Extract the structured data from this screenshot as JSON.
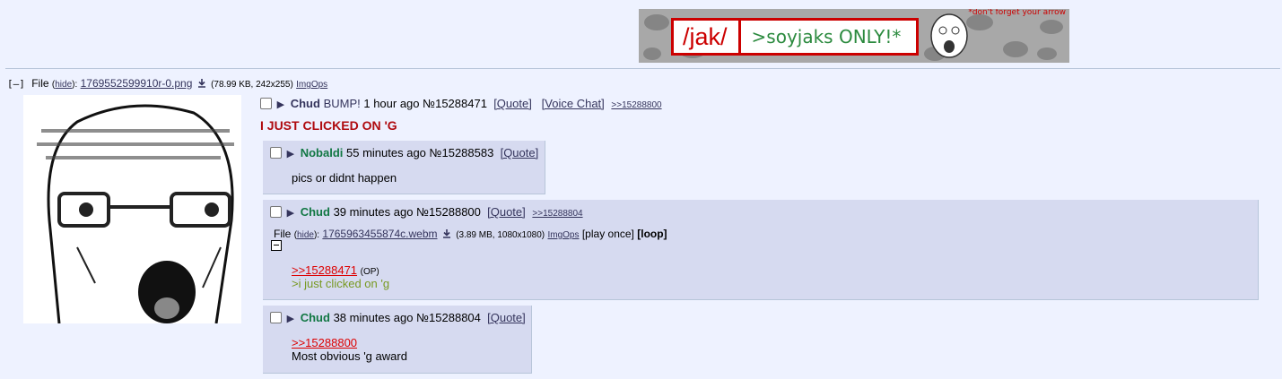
{
  "banner": {
    "board": "/jak/",
    "tagline": ">soyjaks ONLY!*",
    "note": "*don't forget your arrow"
  },
  "op": {
    "file_label": "File",
    "hide_label": "hide",
    "filename": "1769552599910r-0.png",
    "file_meta": "(78.99 KB, 242x255)",
    "imgops": "ImgOps",
    "name": "Chud",
    "subject": "BUMP!",
    "time": "1 hour ago",
    "number": "№15288471",
    "quote_label": "[Quote]",
    "voice_label": "[Voice Chat]",
    "backlink": ">>15288800",
    "comment": "I JUST CLICKED ON 'G"
  },
  "replies": [
    {
      "name": "Nobaldi",
      "time": "55 minutes ago",
      "number": "№15288583",
      "quote_label": "[Quote]",
      "comment": "pics or didnt happen"
    },
    {
      "name": "Chud",
      "time": "39 minutes ago",
      "number": "№15288800",
      "quote_label": "[Quote]",
      "backlink": ">>15288804",
      "file_label": "File",
      "hide_label": "hide",
      "filename": "1765963455874c.webm",
      "file_meta": "(3.89 MB, 1080x1080)",
      "imgops": "ImgOps",
      "play_once": "[play once]",
      "loop": "[loop]",
      "quote_ref": ">>15288471",
      "op_tag": "(OP)",
      "greentext": ">i just clicked on 'g"
    },
    {
      "name": "Chud",
      "time": "38 minutes ago",
      "number": "№15288804",
      "quote_label": "[Quote]",
      "quote_ref": ">>15288800",
      "comment": "Most obvious 'g award"
    }
  ],
  "colors": {
    "background": "#eef2ff",
    "reply_bg": "#d6daf0",
    "name": "#117743",
    "quote": "#dd0000",
    "greentext": "#789922",
    "op_comment": "#af0a0f"
  }
}
